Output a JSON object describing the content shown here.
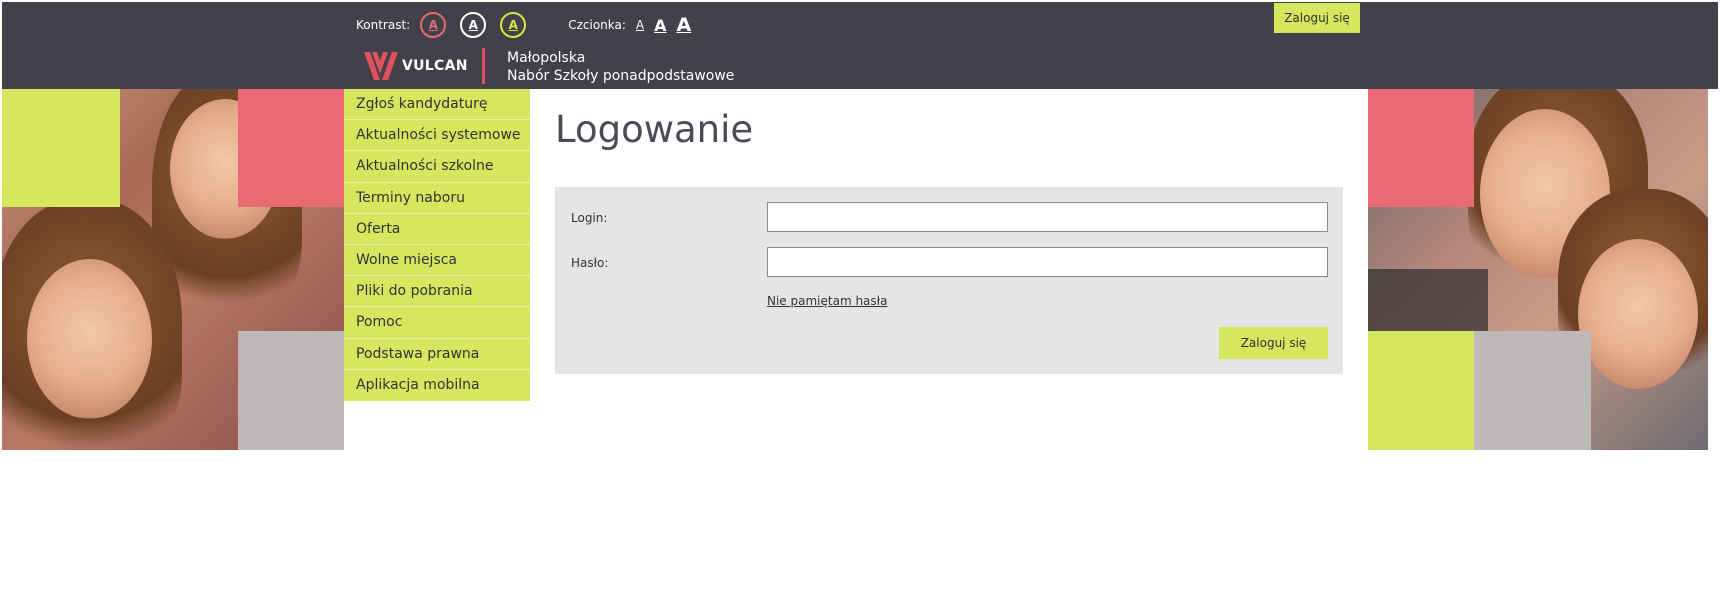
{
  "header": {
    "contrast_label": "Kontrast:",
    "contrast_options": [
      "A",
      "A",
      "A"
    ],
    "font_label": "Czcionka:",
    "font_sizes": [
      "A",
      "A",
      "A"
    ],
    "login_button": "Zaloguj się",
    "logo_text": "VULCAN",
    "region_line1": "Małopolska",
    "region_line2": "Nabór Szkoły ponadpodstawowe"
  },
  "nav": {
    "items": [
      "Zgłoś kandydaturę",
      "Aktualności systemowe",
      "Aktualności szkolne",
      "Terminy naboru",
      "Oferta",
      "Wolne miejsca",
      "Pliki do pobrania",
      "Pomoc",
      "Podstawa prawna",
      "Aplikacja mobilna"
    ]
  },
  "main": {
    "title": "Logowanie",
    "login_label": "Login:",
    "login_value": "",
    "password_label": "Hasło:",
    "password_value": "",
    "forgot_link": "Nie pamiętam hasła",
    "submit_label": "Zaloguj się"
  },
  "colors": {
    "header_bg": "#41404b",
    "accent_green": "#d4e75f",
    "accent_red": "#e86b73",
    "panel_bg": "#e5e5e5",
    "logo_red": "#e0505d"
  }
}
